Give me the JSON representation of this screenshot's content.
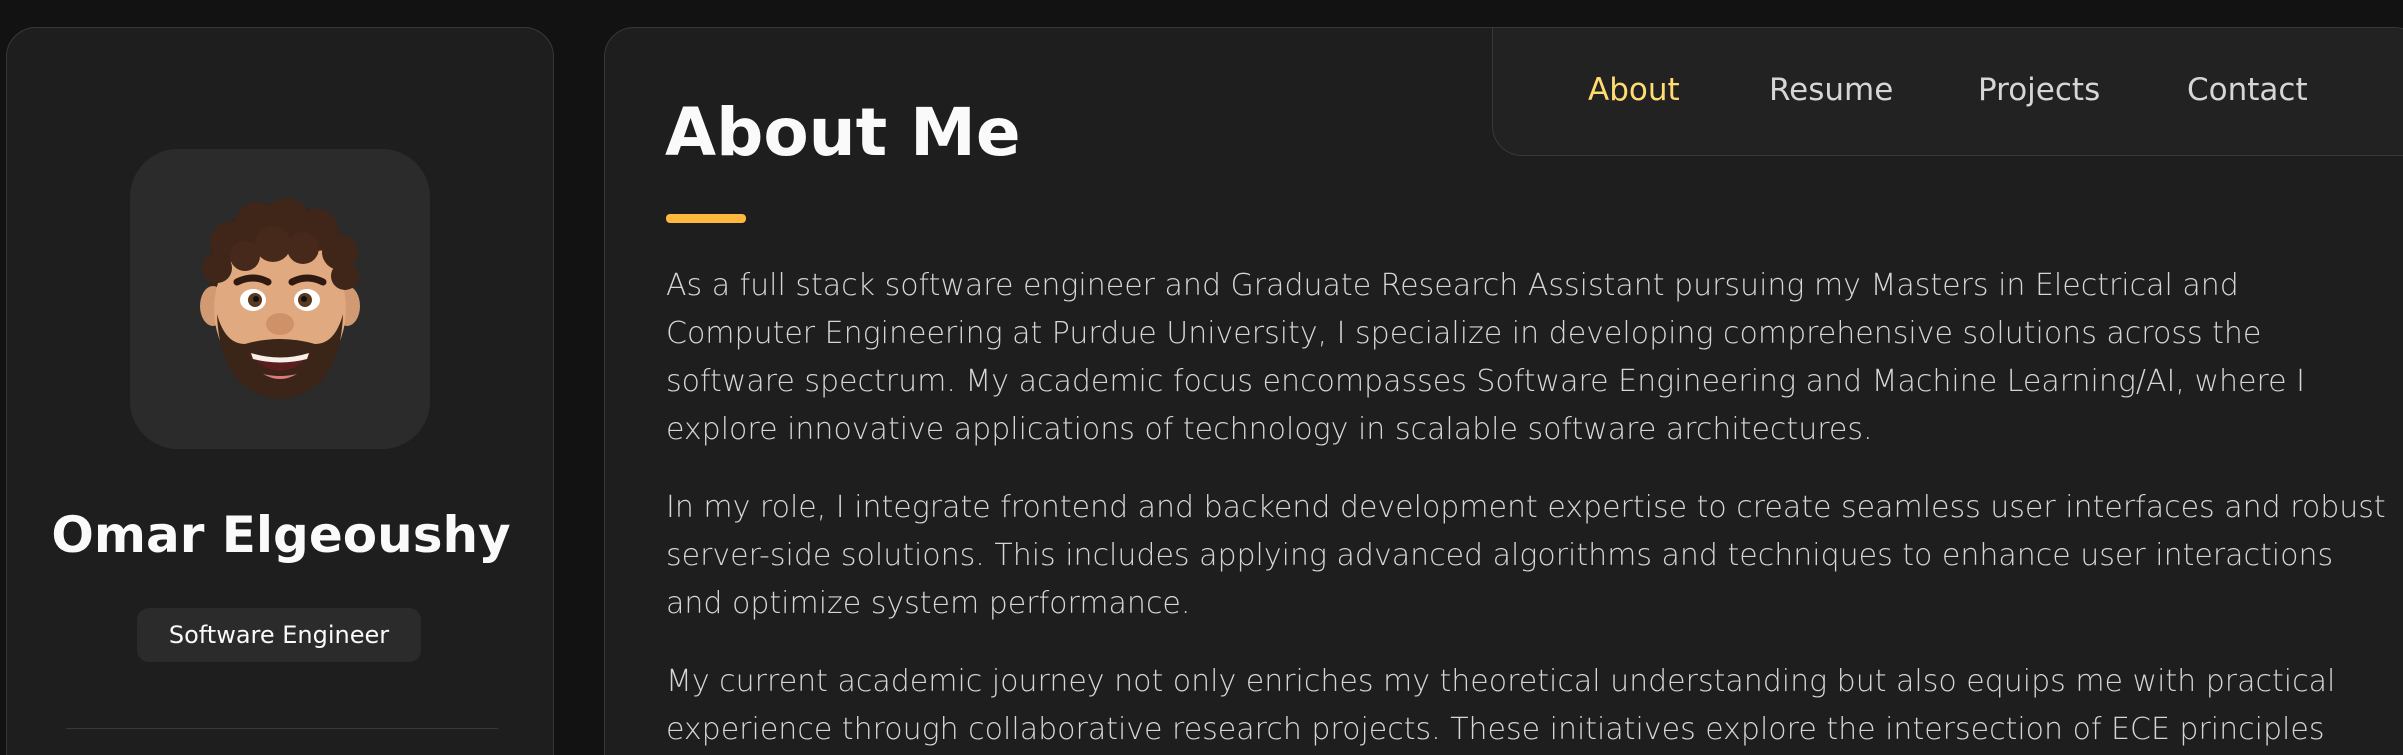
{
  "sidebar": {
    "name": "Omar Elgeoushy",
    "title": "Software Engineer",
    "avatar_icon": "memoji-avatar-icon"
  },
  "navbar": {
    "items": [
      {
        "label": "About",
        "active": true
      },
      {
        "label": "Resume",
        "active": false
      },
      {
        "label": "Projects",
        "active": false
      },
      {
        "label": "Contact",
        "active": false
      }
    ]
  },
  "about": {
    "title": "About Me",
    "paragraphs": [
      "As a full stack software engineer and Graduate Research Assistant pursuing my Masters in Electrical and Computer Engineering at Purdue University, I specialize in developing comprehensive solutions across the software spectrum. My academic focus encompasses Software Engineering and Machine Learning/AI, where I explore innovative applications of technology in scalable software architectures.",
      "In my role, I integrate frontend and backend development expertise to create seamless user interfaces and robust server-side solutions. This includes applying advanced algorithms and techniques to enhance user interactions and optimize system performance.",
      "My current academic journey not only enriches my theoretical understanding but also equips me with practical experience through collaborative research projects. These initiatives explore the intersection of ECE principles"
    ]
  },
  "colors": {
    "accent": "#ffdb70",
    "accent_bar": "#ffb83f",
    "background": "#121212",
    "card": "#1e1e1f"
  }
}
